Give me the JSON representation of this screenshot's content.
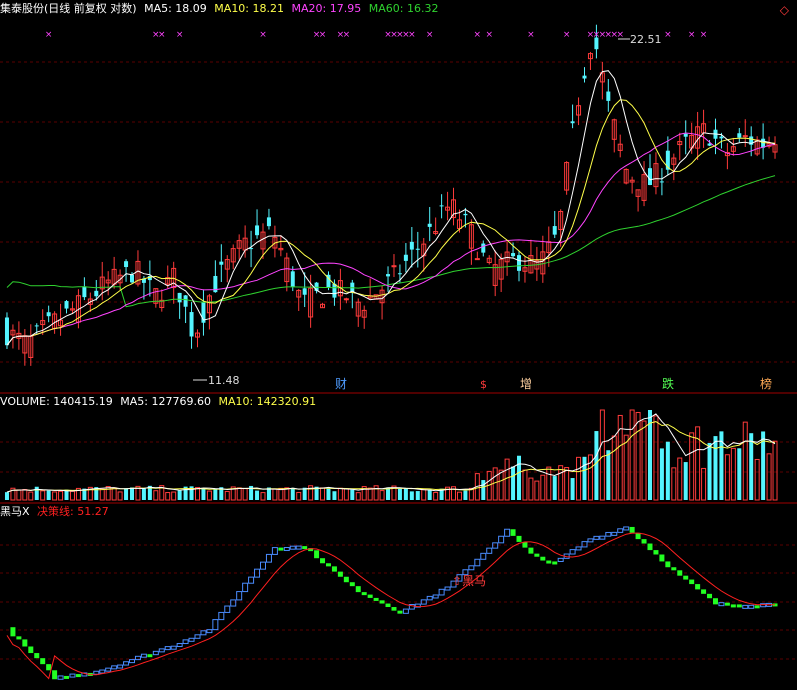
{
  "colors": {
    "background": "#000000",
    "grid": "#5a0000",
    "up": "#ff3b3b",
    "down": "#54f5ff",
    "ma5": "#ffffff",
    "ma10": "#ffff4a",
    "ma20": "#ff44ff",
    "ma60": "#2fd22f",
    "decision": "#ff2020",
    "heima_up": "#4a8cff",
    "heima_down": "#22ff22",
    "signal": "#ff44ff"
  },
  "price_panel": {
    "name": "集泰股份(日线 前复权 对数)",
    "ma5": "MA5: 18.09",
    "ma10": "MA10: 18.21",
    "ma20": "MA20: 17.95",
    "ma60": "MA60: 16.32",
    "high_label": "22.51",
    "low_label": "11.48",
    "markers": [
      "财",
      "$",
      "增",
      "跌",
      "榜"
    ]
  },
  "volume_panel": {
    "volume": "VOLUME: 140415.19",
    "ma5": "MA5: 127769.60",
    "ma10": "MA10: 142320.91"
  },
  "indicator_panel": {
    "name": "黑马X",
    "decision": "决策线: 51.27",
    "signal_label": "黑马"
  },
  "chart_data": [
    {
      "type": "candlestick",
      "title": "集泰股份(日线 前复权 对数)",
      "scale": "log",
      "series": [
        {
          "name": "MA5",
          "last": 18.09
        },
        {
          "name": "MA10",
          "last": 18.21
        },
        {
          "name": "MA20",
          "last": 17.95
        },
        {
          "name": "MA60",
          "last": 16.32
        }
      ],
      "annotations": {
        "high": 22.51,
        "low": 11.48
      }
    },
    {
      "type": "bar",
      "title": "VOLUME",
      "series": [
        {
          "name": "VOLUME",
          "last": 140415.19
        },
        {
          "name": "MA5",
          "last": 127769.6
        },
        {
          "name": "MA10",
          "last": 142320.91
        }
      ]
    },
    {
      "type": "line",
      "title": "黑马X",
      "series": [
        {
          "name": "决策线",
          "last": 51.27
        }
      ]
    }
  ]
}
